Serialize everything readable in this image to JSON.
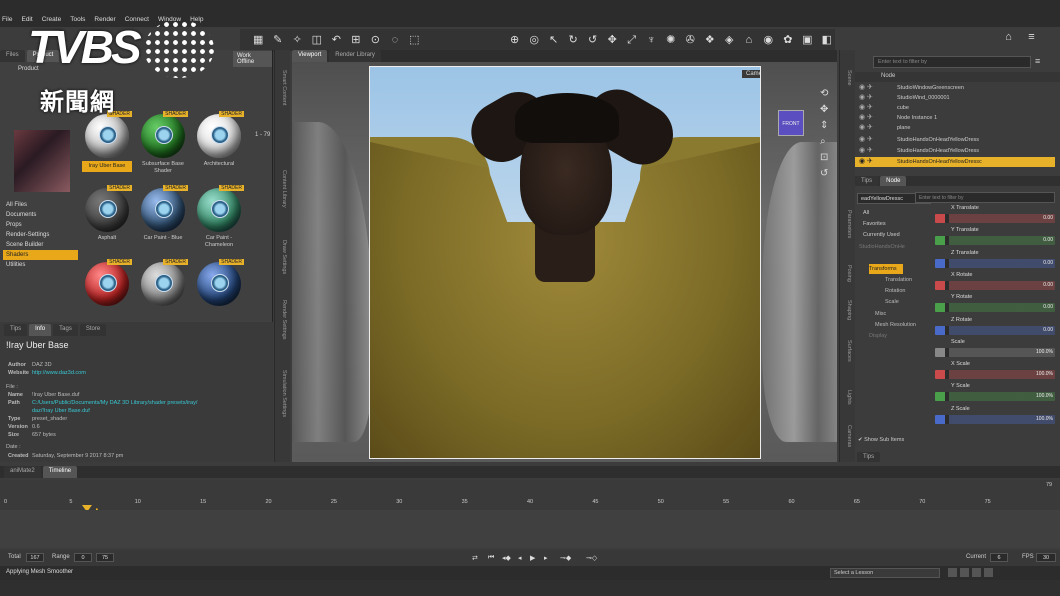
{
  "menu": [
    "File",
    "Edit",
    "Create",
    "Tools",
    "Render",
    "Connect",
    "Window",
    "Help"
  ],
  "logo": {
    "brand": "TVBS",
    "chinese": "新聞網"
  },
  "smart_content": {
    "tabs": [
      "Files",
      "Product"
    ],
    "work_offline": "Work Offline",
    "product_label": "Product",
    "range": "1 - 79",
    "categories": [
      "All Files",
      "Documents",
      "Props",
      "Render-Settings",
      "Scene Builder",
      "Shaders",
      "Utilities"
    ],
    "selected_category": "Shaders",
    "tiles": [
      {
        "label": "Iray Uber Base",
        "badge": "SHADER"
      },
      {
        "label": "Subsurface Base Shader",
        "badge": "SHADER"
      },
      {
        "label": "Architectural",
        "badge": "SHADER"
      },
      {
        "label": "Asphalt",
        "badge": "SHADER"
      },
      {
        "label": "Car Paint - Blue",
        "badge": "SHADER"
      },
      {
        "label": "Car Paint - Chameleon",
        "badge": "SHADER"
      },
      {
        "label": "",
        "badge": "SHADER"
      },
      {
        "label": "",
        "badge": "SHADER"
      },
      {
        "label": "",
        "badge": "SHADER"
      }
    ]
  },
  "info_panel": {
    "tabs": [
      "Tips",
      "Info",
      "Tags",
      "Store"
    ],
    "title": "!Iray Uber Base",
    "author_key": "Author",
    "author": "DAZ 3D",
    "website_key": "Website",
    "website": "http://www.daz3d.com",
    "file_key": "File :",
    "name_key": "Name",
    "name": "!Iray Uber Base.duf",
    "path_key": "Path",
    "path": "C:/Users/Public/Documents/My DAZ 3D Library/shader presets/iray/",
    "path2": "daz/!Iray Uber Base.duf",
    "type_key": "Type",
    "type": "preset_shader",
    "version_key": "Version",
    "version": "0.6",
    "size_key": "Size",
    "size": "657 bytes",
    "dates_key": "Date :",
    "created_key": "Created",
    "created": "Saturday, September 9 2017 8:37 pm"
  },
  "left_strip_tabs": [
    "Smart Content",
    "Content Library",
    "Draw Settings",
    "Render Settings",
    "Simulation Settings"
  ],
  "viewport": {
    "tabs": [
      "Viewport",
      "Render Library"
    ],
    "camera": "Camera 2",
    "navcube_label": "FRONT"
  },
  "scene": {
    "search_placeholder": "Enter text to filter by",
    "header": "Node",
    "nodes": [
      "StudioWindowGreenscreen",
      "StudioWind_0000001",
      "cube",
      "Node Instance 1",
      "plane",
      "StudioHandsOnHeadYellowDress",
      "StudioHandsOnHeadYellowDress",
      "StudioHandsOnHeadYellowDressc"
    ],
    "selected_index": 7
  },
  "param_tabs": [
    "Tips",
    "Node"
  ],
  "parameters": {
    "dropdown": "eadYellowDressc",
    "search_placeholder": "Enter text to filter by",
    "categories": [
      "All",
      "Favorites",
      "Currently Used"
    ],
    "tree": [
      "StudioHandsOnHe",
      "Transforms",
      "Translation",
      "Rotation",
      "Scale",
      "Misc",
      "Mesh Resolution",
      "Display"
    ],
    "selected_tree": "Transforms",
    "sliders": [
      {
        "label": "X Translate",
        "value": "0.00",
        "color": "#c94a4a"
      },
      {
        "label": "Y Translate",
        "value": "0.00",
        "color": "#4aa04a"
      },
      {
        "label": "Z Translate",
        "value": "0.00",
        "color": "#4a6ac9"
      },
      {
        "label": "X Rotate",
        "value": "0.00",
        "color": "#c94a4a"
      },
      {
        "label": "Y Rotate",
        "value": "0.00",
        "color": "#4aa04a"
      },
      {
        "label": "Z Rotate",
        "value": "0.00",
        "color": "#4a6ac9"
      },
      {
        "label": "Scale",
        "value": "100.0%",
        "color": "#888888"
      },
      {
        "label": "X Scale",
        "value": "100.0%",
        "color": "#c94a4a"
      },
      {
        "label": "Y Scale",
        "value": "100.0%",
        "color": "#4aa04a"
      },
      {
        "label": "Z Scale",
        "value": "100.0%",
        "color": "#4a6ac9"
      }
    ],
    "show_sub_items": "Show Sub Items",
    "bottom_tab": "Tips"
  },
  "right_strip_tabs": [
    "Scene",
    "Parameters",
    "Posing",
    "Shaping",
    "Surfaces",
    "Lights",
    "Cameras"
  ],
  "timeline": {
    "tabs": [
      "aniMate2",
      "Timeline"
    ],
    "ticks": [
      "0",
      "5",
      "10",
      "15",
      "20",
      "25",
      "30",
      "35",
      "40",
      "45",
      "50",
      "55",
      "60",
      "65",
      "70",
      "75"
    ],
    "end_tick": "79",
    "total_label": "Total",
    "total": "167",
    "range_label": "Range",
    "range_start": "0",
    "range_end": "75",
    "current_label": "Current",
    "current": "6",
    "fps_label": "FPS",
    "fps": "30"
  },
  "status": {
    "message": "Applying Mesh Smoother",
    "lesson": "Select a Lesson"
  }
}
